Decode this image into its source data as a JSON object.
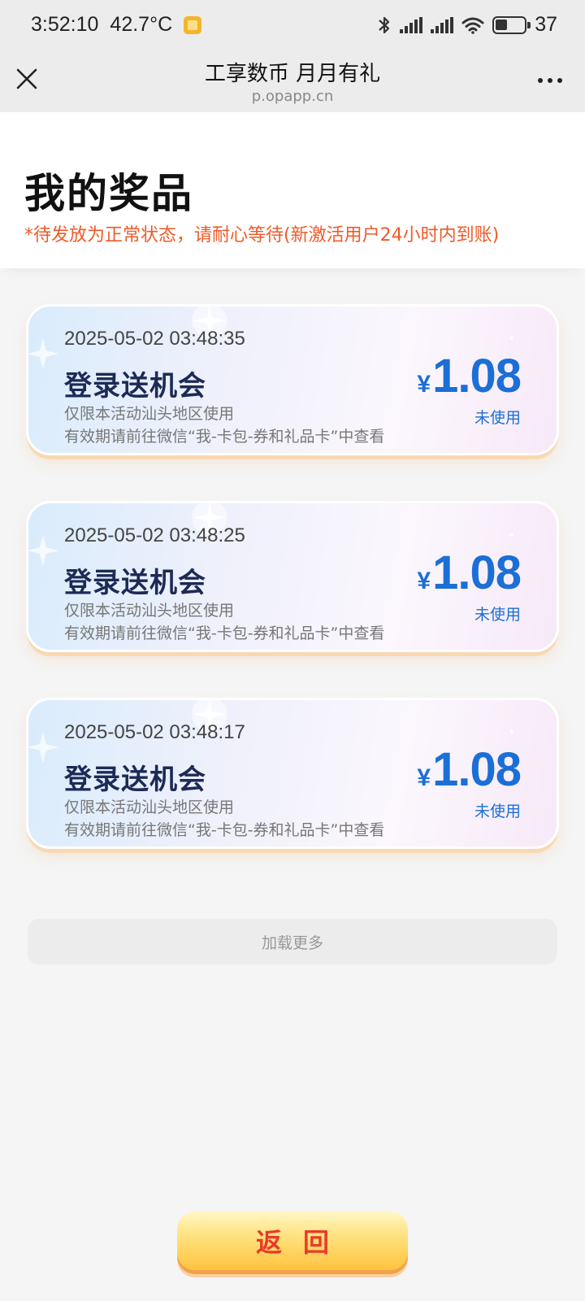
{
  "status_bar": {
    "time": "3:52:10",
    "temperature": "42.7°C",
    "battery": "37"
  },
  "nav": {
    "title": "工享数币 月月有礼",
    "subtitle": "p.opapp.cn"
  },
  "header": {
    "title": "我的奖品",
    "notice": "*待发放为正常状态，请耐心等待(新激活用户24小时内到账)"
  },
  "prizes": [
    {
      "time": "2025-05-02 03:48:35",
      "title": "登录送机会",
      "region_note": "仅限本活动汕头地区使用",
      "validity_note": "有效期请前往微信“我-卡包-券和礼品卡”中查看",
      "currency": "¥",
      "amount": "1.08",
      "status": "未使用"
    },
    {
      "time": "2025-05-02 03:48:25",
      "title": "登录送机会",
      "region_note": "仅限本活动汕头地区使用",
      "validity_note": "有效期请前往微信“我-卡包-券和礼品卡”中查看",
      "currency": "¥",
      "amount": "1.08",
      "status": "未使用"
    },
    {
      "time": "2025-05-02 03:48:17",
      "title": "登录送机会",
      "region_note": "仅限本活动汕头地区使用",
      "validity_note": "有效期请前往微信“我-卡包-券和礼品卡”中查看",
      "currency": "¥",
      "amount": "1.08",
      "status": "未使用"
    }
  ],
  "load_more": "加载更多",
  "back_button": "返回",
  "colors": {
    "accent": "#1b6fd6",
    "notice": "#ef5a28",
    "button_text": "#ea3a2a"
  }
}
